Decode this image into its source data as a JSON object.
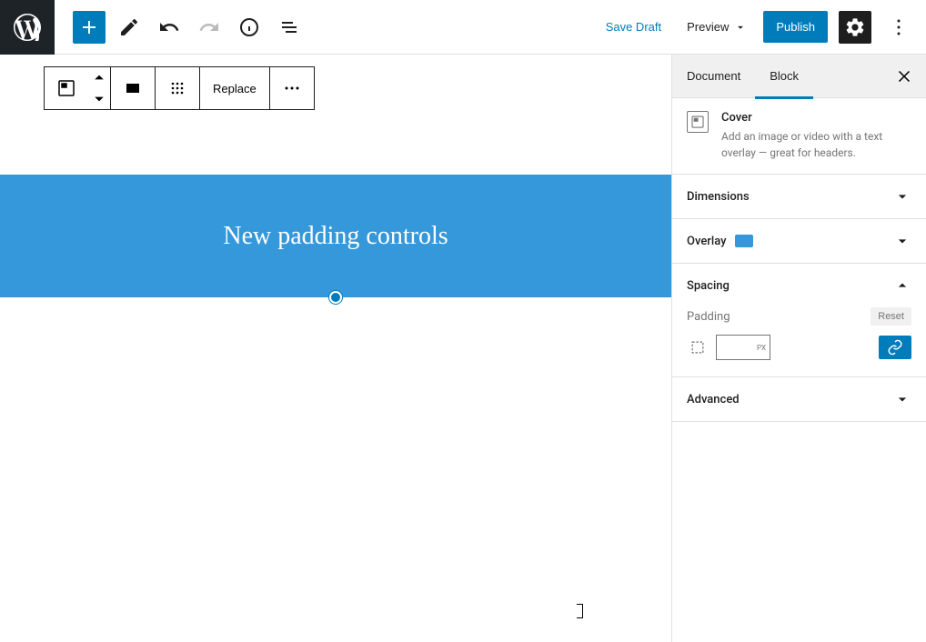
{
  "topbar": {
    "save_draft": "Save Draft",
    "preview": "Preview",
    "publish": "Publish"
  },
  "block_toolbar": {
    "replace": "Replace"
  },
  "cover": {
    "text": "New padding controls",
    "overlay_color": "#3498db"
  },
  "sidebar": {
    "tabs": {
      "document": "Document",
      "block": "Block"
    },
    "block_info": {
      "name": "Cover",
      "description": "Add an image or video with a text overlay — great for headers."
    },
    "panels": {
      "dimensions": "Dimensions",
      "overlay": "Overlay",
      "spacing": "Spacing",
      "advanced": "Advanced"
    },
    "spacing": {
      "padding_label": "Padding",
      "reset": "Reset",
      "unit": "PX"
    }
  }
}
